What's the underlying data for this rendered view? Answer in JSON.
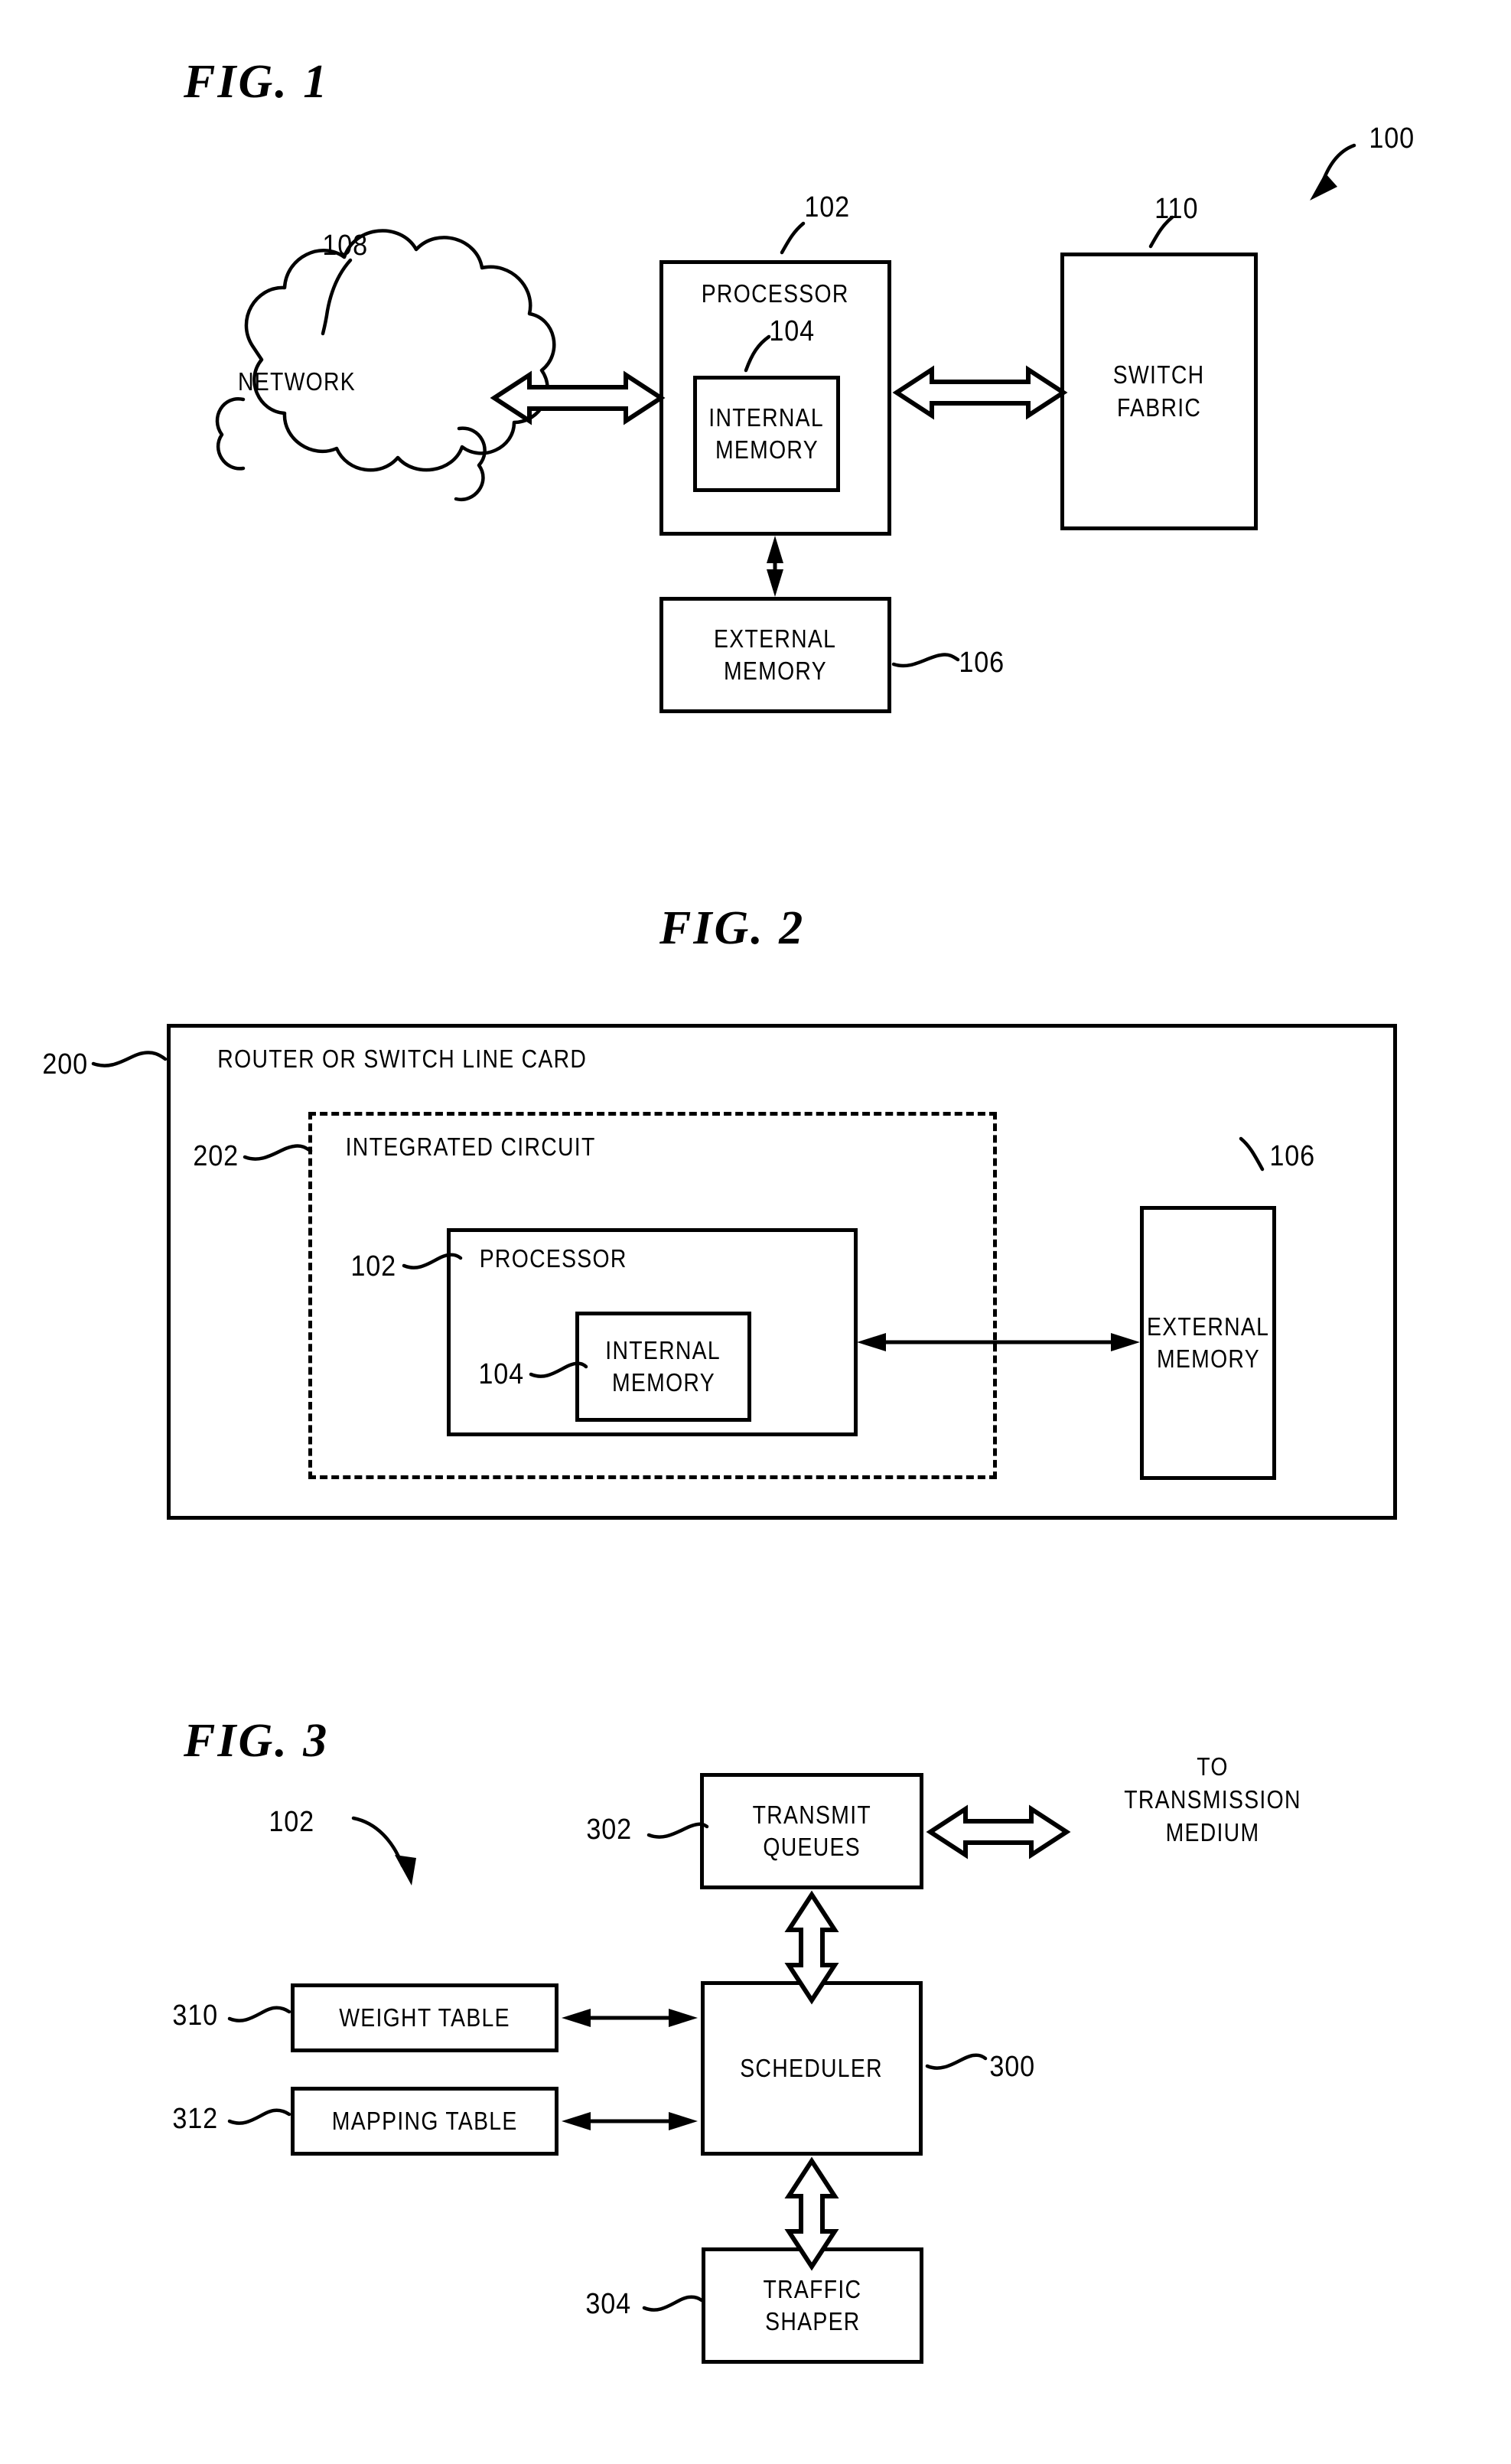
{
  "figures": [
    {
      "title": "FIG.  1",
      "system_ref": "100",
      "blocks": [
        {
          "id": "network",
          "label": "NETWORK",
          "ref": "108"
        },
        {
          "id": "processor",
          "label": "PROCESSOR",
          "ref": "102"
        },
        {
          "id": "internal_memory",
          "label_line1": "INTERNAL",
          "label_line2": "MEMORY",
          "ref": "104"
        },
        {
          "id": "external_memory",
          "label_line1": "EXTERNAL",
          "label_line2": "MEMORY",
          "ref": "106"
        },
        {
          "id": "switch_fabric",
          "label_line1": "SWITCH",
          "label_line2": "FABRIC",
          "ref": "110"
        }
      ]
    },
    {
      "title": "FIG.  2",
      "blocks": [
        {
          "id": "line_card",
          "label": "ROUTER OR SWITCH LINE CARD",
          "ref": "200"
        },
        {
          "id": "integrated_circuit",
          "label": "INTEGRATED  CIRCUIT",
          "ref": "202"
        },
        {
          "id": "processor",
          "label": "PROCESSOR",
          "ref": "102"
        },
        {
          "id": "internal_memory",
          "label_line1": "INTERNAL",
          "label_line2": "MEMORY",
          "ref": "104"
        },
        {
          "id": "external_memory",
          "label_line1": "EXTERNAL",
          "label_line2": "MEMORY",
          "ref": "106"
        }
      ]
    },
    {
      "title": "FIG.  3",
      "system_ref": "102",
      "blocks": [
        {
          "id": "transmit_queues",
          "label_line1": "TRANSMIT",
          "label_line2": "QUEUES",
          "ref": "302"
        },
        {
          "id": "scheduler",
          "label": "SCHEDULER",
          "ref": "300"
        },
        {
          "id": "weight_table",
          "label": "WEIGHT  TABLE",
          "ref": "310"
        },
        {
          "id": "mapping_table",
          "label": "MAPPING  TABLE",
          "ref": "312"
        },
        {
          "id": "traffic_shaper",
          "label_line1": "TRAFFIC",
          "label_line2": "SHAPER",
          "ref": "304"
        }
      ],
      "annotations": [
        {
          "id": "to_transmission_medium",
          "line1": "TO",
          "line2": "TRANSMISSION",
          "line3": "MEDIUM"
        }
      ]
    }
  ],
  "colors": {
    "ink": "#000000",
    "paper": "#ffffff"
  }
}
